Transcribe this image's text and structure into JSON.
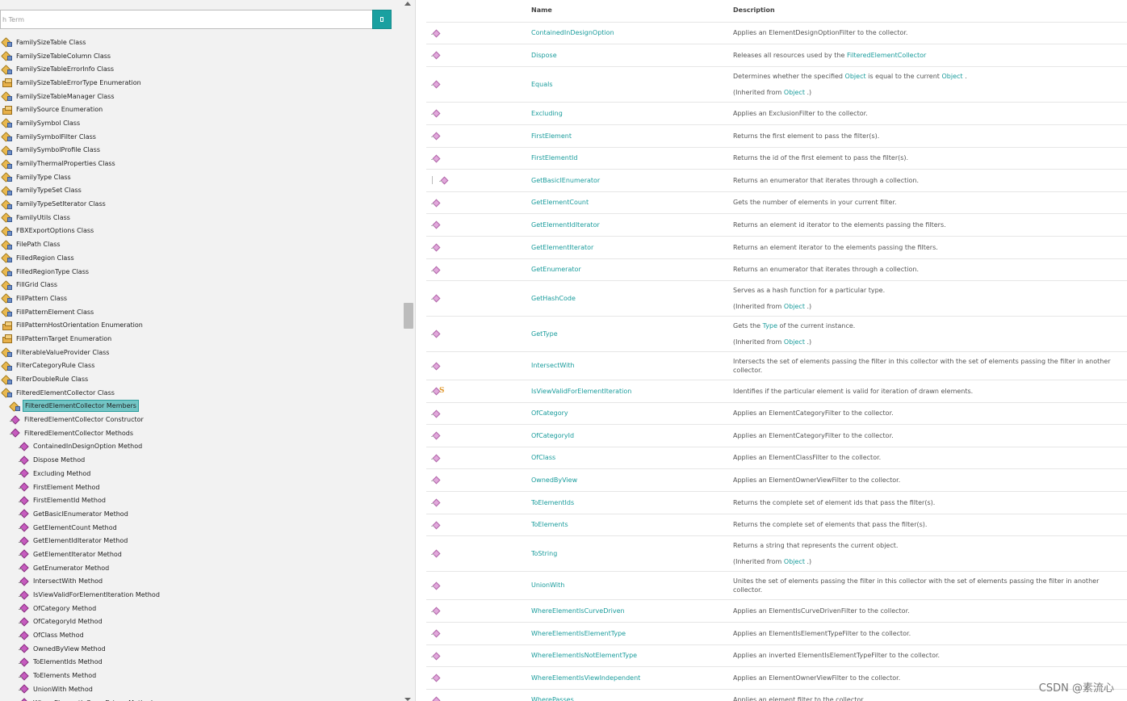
{
  "search": {
    "placeholder": "h Term"
  },
  "tree": [
    {
      "label": "FamilySizeTable Class",
      "kind": "class",
      "level": 0
    },
    {
      "label": "FamilySizeTableColumn Class",
      "kind": "class",
      "level": 0
    },
    {
      "label": "FamilySizeTableErrorInfo Class",
      "kind": "class",
      "level": 0
    },
    {
      "label": "FamilySizeTableErrorType Enumeration",
      "kind": "enum",
      "level": 0
    },
    {
      "label": "FamilySizeTableManager Class",
      "kind": "class",
      "level": 0
    },
    {
      "label": "FamilySource Enumeration",
      "kind": "enum",
      "level": 0
    },
    {
      "label": "FamilySymbol Class",
      "kind": "class",
      "level": 0
    },
    {
      "label": "FamilySymbolFilter Class",
      "kind": "class",
      "level": 0
    },
    {
      "label": "FamilySymbolProfile Class",
      "kind": "class",
      "level": 0
    },
    {
      "label": "FamilyThermalProperties Class",
      "kind": "class",
      "level": 0
    },
    {
      "label": "FamilyType Class",
      "kind": "class",
      "level": 0
    },
    {
      "label": "FamilyTypeSet Class",
      "kind": "class",
      "level": 0
    },
    {
      "label": "FamilyTypeSetIterator Class",
      "kind": "class",
      "level": 0
    },
    {
      "label": "FamilyUtils Class",
      "kind": "class",
      "level": 0
    },
    {
      "label": "FBXExportOptions Class",
      "kind": "class",
      "level": 0
    },
    {
      "label": "FilePath Class",
      "kind": "class",
      "level": 0
    },
    {
      "label": "FilledRegion Class",
      "kind": "class",
      "level": 0
    },
    {
      "label": "FilledRegionType Class",
      "kind": "class",
      "level": 0
    },
    {
      "label": "FillGrid Class",
      "kind": "class",
      "level": 0
    },
    {
      "label": "FillPattern Class",
      "kind": "class",
      "level": 0
    },
    {
      "label": "FillPatternElement Class",
      "kind": "class",
      "level": 0
    },
    {
      "label": "FillPatternHostOrientation Enumeration",
      "kind": "enum",
      "level": 0
    },
    {
      "label": "FillPatternTarget Enumeration",
      "kind": "enum",
      "level": 0
    },
    {
      "label": "FilterableValueProvider Class",
      "kind": "class",
      "level": 0
    },
    {
      "label": "FilterCategoryRule Class",
      "kind": "class",
      "level": 0
    },
    {
      "label": "FilterDoubleRule Class",
      "kind": "class",
      "level": 0
    },
    {
      "label": "FilteredElementCollector Class",
      "kind": "class",
      "level": 0
    },
    {
      "label": "FilteredElementCollector Members",
      "kind": "class",
      "level": 1,
      "selected": true
    },
    {
      "label": "FilteredElementCollector Constructor",
      "kind": "method",
      "level": 1
    },
    {
      "label": "FilteredElementCollector Methods",
      "kind": "method",
      "level": 1
    },
    {
      "label": "ContainedInDesignOption Method",
      "kind": "method",
      "level": 2
    },
    {
      "label": "Dispose Method",
      "kind": "method",
      "level": 2
    },
    {
      "label": "Excluding Method",
      "kind": "method",
      "level": 2
    },
    {
      "label": "FirstElement Method",
      "kind": "method",
      "level": 2
    },
    {
      "label": "FirstElementId Method",
      "kind": "method",
      "level": 2
    },
    {
      "label": "GetBasicIEnumerator Method",
      "kind": "method",
      "level": 2
    },
    {
      "label": "GetElementCount Method",
      "kind": "method",
      "level": 2
    },
    {
      "label": "GetElementIdIterator Method",
      "kind": "method",
      "level": 2
    },
    {
      "label": "GetElementIterator Method",
      "kind": "method",
      "level": 2
    },
    {
      "label": "GetEnumerator Method",
      "kind": "method",
      "level": 2
    },
    {
      "label": "IntersectWith Method",
      "kind": "method",
      "level": 2
    },
    {
      "label": "IsViewValidForElementIteration Method",
      "kind": "method",
      "level": 2
    },
    {
      "label": "OfCategory Method",
      "kind": "method",
      "level": 2
    },
    {
      "label": "OfCategoryId Method",
      "kind": "method",
      "level": 2
    },
    {
      "label": "OfClass Method",
      "kind": "method",
      "level": 2
    },
    {
      "label": "OwnedByView Method",
      "kind": "method",
      "level": 2
    },
    {
      "label": "ToElementIds Method",
      "kind": "method",
      "level": 2
    },
    {
      "label": "ToElements Method",
      "kind": "method",
      "level": 2
    },
    {
      "label": "UnionWith Method",
      "kind": "method",
      "level": 2
    },
    {
      "label": "WhereElementIsCurveDriven Method",
      "kind": "method",
      "level": 2
    }
  ],
  "table": {
    "headers": {
      "name": "Name",
      "description": "Description"
    },
    "rows": [
      {
        "name": "ContainedInDesignOption",
        "h": 27,
        "icons": [
          "method"
        ],
        "desc": [
          [
            "Applies an ElementDesignOptionFilter to the collector."
          ]
        ]
      },
      {
        "name": "Dispose",
        "h": 28,
        "icons": [
          "method"
        ],
        "desc": [
          [
            "Releases all resources used by the ",
            {
              "link": "FilteredElementCollector"
            }
          ]
        ]
      },
      {
        "name": "Equals",
        "h": 41,
        "icons": [
          "method"
        ],
        "desc": [
          [
            "Determines whether the specified ",
            {
              "link": "Object"
            },
            " is equal to the current ",
            {
              "link": "Object"
            },
            " ."
          ],
          [
            "(Inherited from ",
            {
              "link": "Object"
            },
            " .)"
          ]
        ]
      },
      {
        "name": "Excluding",
        "h": 28,
        "icons": [
          "method"
        ],
        "desc": [
          [
            "Applies an ExclusionFilter to the collector."
          ]
        ]
      },
      {
        "name": "FirstElement",
        "h": 28,
        "icons": [
          "method"
        ],
        "desc": [
          [
            "Returns the first element to pass the filter(s)."
          ]
        ]
      },
      {
        "name": "FirstElementId",
        "h": 27,
        "icons": [
          "method"
        ],
        "desc": [
          [
            "Returns the id of the first element to pass the filter(s)."
          ]
        ]
      },
      {
        "name": "GetBasicIEnumerator",
        "h": 28,
        "icons": [
          "explicit",
          "method"
        ],
        "desc": [
          [
            "Returns an enumerator that iterates through a collection."
          ]
        ]
      },
      {
        "name": "GetElementCount",
        "h": 27,
        "icons": [
          "method"
        ],
        "desc": [
          [
            "Gets the number of elements in your current filter."
          ]
        ]
      },
      {
        "name": "GetElementIdIterator",
        "h": 28,
        "icons": [
          "method"
        ],
        "desc": [
          [
            "Returns an element id iterator to the elements passing the filters."
          ]
        ]
      },
      {
        "name": "GetElementIterator",
        "h": 28,
        "icons": [
          "method"
        ],
        "desc": [
          [
            "Returns an element iterator to the elements passing the filters."
          ]
        ]
      },
      {
        "name": "GetEnumerator",
        "h": 27,
        "icons": [
          "method"
        ],
        "desc": [
          [
            "Returns an enumerator that iterates through a collection."
          ]
        ]
      },
      {
        "name": "GetHashCode",
        "h": 41,
        "icons": [
          "method"
        ],
        "desc": [
          [
            "Serves as a hash function for a particular type."
          ],
          [
            "(Inherited from ",
            {
              "link": "Object"
            },
            " .)"
          ]
        ]
      },
      {
        "name": "GetType",
        "h": 41,
        "icons": [
          "method"
        ],
        "desc": [
          [
            "Gets the ",
            {
              "link": "Type"
            },
            " of the current instance."
          ],
          [
            "(Inherited from ",
            {
              "link": "Object"
            },
            " .)"
          ]
        ]
      },
      {
        "name": "IntersectWith",
        "h": 28,
        "icons": [
          "method"
        ],
        "desc": [
          [
            "Intersects the set of elements passing the filter in this collector with the set of elements passing the filter in another collector."
          ]
        ]
      },
      {
        "name": "IsViewValidForElementIteration",
        "h": 28,
        "icons": [
          "method",
          "static"
        ],
        "desc": [
          [
            "Identifies if the particular element is valid for iteration of drawn elements."
          ]
        ]
      },
      {
        "name": "OfCategory",
        "h": 27,
        "icons": [
          "method"
        ],
        "desc": [
          [
            "Applies an ElementCategoryFilter to the collector."
          ]
        ]
      },
      {
        "name": "OfCategoryId",
        "h": 28,
        "icons": [
          "method"
        ],
        "desc": [
          [
            "Applies an ElementCategoryFilter to the collector."
          ]
        ]
      },
      {
        "name": "OfClass",
        "h": 27,
        "icons": [
          "method"
        ],
        "desc": [
          [
            "Applies an ElementClassFilter to the collector."
          ]
        ]
      },
      {
        "name": "OwnedByView",
        "h": 28,
        "icons": [
          "method"
        ],
        "desc": [
          [
            "Applies an ElementOwnerViewFilter to the collector."
          ]
        ]
      },
      {
        "name": "ToElementIds",
        "h": 28,
        "icons": [
          "method"
        ],
        "desc": [
          [
            "Returns the complete set of element ids that pass the filter(s)."
          ]
        ]
      },
      {
        "name": "ToElements",
        "h": 27,
        "icons": [
          "method"
        ],
        "desc": [
          [
            "Returns the complete set of elements that pass the filter(s)."
          ]
        ]
      },
      {
        "name": "ToString",
        "h": 41,
        "icons": [
          "method"
        ],
        "desc": [
          [
            "Returns a string that represents the current object."
          ],
          [
            "(Inherited from ",
            {
              "link": "Object"
            },
            " .)"
          ]
        ]
      },
      {
        "name": "UnionWith",
        "h": 28,
        "icons": [
          "method"
        ],
        "desc": [
          [
            "Unites the set of elements passing the filter in this collector with the set of elements passing the filter in another collector."
          ]
        ]
      },
      {
        "name": "WhereElementIsCurveDriven",
        "h": 28,
        "icons": [
          "method"
        ],
        "desc": [
          [
            "Applies an ElementIsCurveDrivenFilter to the collector."
          ]
        ]
      },
      {
        "name": "WhereElementIsElementType",
        "h": 28,
        "icons": [
          "method"
        ],
        "desc": [
          [
            "Applies an ElementIsElementTypeFilter to the collector."
          ]
        ]
      },
      {
        "name": "WhereElementIsNotElementType",
        "h": 27,
        "icons": [
          "method"
        ],
        "desc": [
          [
            "Applies an inverted ElementIsElementTypeFilter to the collector."
          ]
        ]
      },
      {
        "name": "WhereElementIsViewIndependent",
        "h": 28,
        "icons": [
          "method"
        ],
        "desc": [
          [
            "Applies an ElementOwnerViewFilter to the collector."
          ]
        ]
      },
      {
        "name": "WherePasses",
        "h": 27,
        "icons": [
          "method"
        ],
        "desc": [
          [
            "Applies an element filter to the collector."
          ]
        ]
      }
    ]
  },
  "watermark": "CSDN @素流心",
  "colors": {
    "accent": "#1aa0a0",
    "link": "#1a9c9c",
    "selected": "#73c5c5"
  }
}
